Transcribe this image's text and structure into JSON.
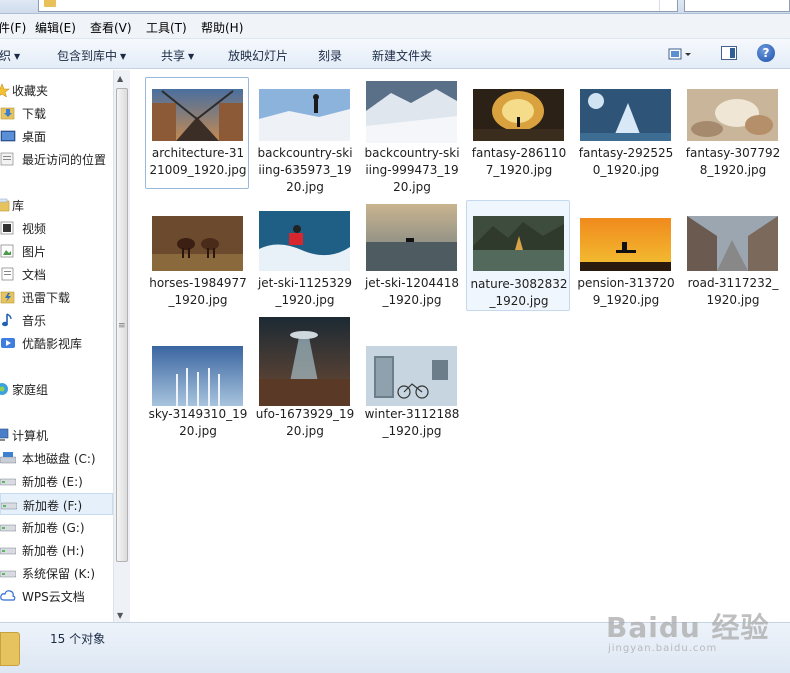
{
  "menubar": {
    "items": [
      "件(F)",
      "编辑(E)",
      "查看(V)",
      "工具(T)",
      "帮助(H)"
    ]
  },
  "toolbar": {
    "organize": "织",
    "include_library": "包含到库中",
    "share": "共享",
    "slideshow": "放映幻灯片",
    "burn": "刻录",
    "new_folder": "新建文件夹",
    "help_glyph": "?"
  },
  "nav": {
    "favorites": "收藏夹",
    "downloads": "下载",
    "desktop": "桌面",
    "recent": "最近访问的位置",
    "libraries": "库",
    "videos": "视频",
    "pictures": "图片",
    "documents": "文档",
    "thunder": "迅雷下载",
    "music": "音乐",
    "youku": "优酷影视库",
    "homegroup": "家庭组",
    "computer": "计算机",
    "drive_c": "本地磁盘 (C:)",
    "drive_e": "新加卷 (E:)",
    "drive_f": "新加卷 (F:)",
    "drive_g": "新加卷 (G:)",
    "drive_h": "新加卷 (H:)",
    "drive_k": "系统保留 (K:)",
    "wps": "WPS云文档"
  },
  "files": [
    {
      "l1": "architecture-31",
      "l2": "21009_1920.jpg",
      "l3": ""
    },
    {
      "l1": "backcountry-ski",
      "l2": "iing-635973_19",
      "l3": "20.jpg"
    },
    {
      "l1": "backcountry-ski",
      "l2": "iing-999473_19",
      "l3": "20.jpg"
    },
    {
      "l1": "fantasy-286110",
      "l2": "7_1920.jpg",
      "l3": ""
    },
    {
      "l1": "fantasy-292525",
      "l2": "0_1920.jpg",
      "l3": ""
    },
    {
      "l1": "fantasy-307792",
      "l2": "8_1920.jpg",
      "l3": ""
    },
    {
      "l1": "horses-1984977",
      "l2": "_1920.jpg",
      "l3": ""
    },
    {
      "l1": "jet-ski-1125329",
      "l2": "_1920.jpg",
      "l3": ""
    },
    {
      "l1": "jet-ski-1204418",
      "l2": "_1920.jpg",
      "l3": ""
    },
    {
      "l1": "nature-3082832",
      "l2": "_1920.jpg",
      "l3": ""
    },
    {
      "l1": "pension-313720",
      "l2": "9_1920.jpg",
      "l3": ""
    },
    {
      "l1": "road-3117232_",
      "l2": "1920.jpg",
      "l3": ""
    },
    {
      "l1": "sky-3149310_19",
      "l2": "20.jpg",
      "l3": ""
    },
    {
      "l1": "ufo-1673929_19",
      "l2": "20.jpg",
      "l3": ""
    },
    {
      "l1": "winter-3112188",
      "l2": "_1920.jpg",
      "l3": ""
    }
  ],
  "status": {
    "count": "15 个对象"
  },
  "watermark": {
    "brand": "Baidu 经验",
    "url": "jingyan.baidu.com"
  }
}
